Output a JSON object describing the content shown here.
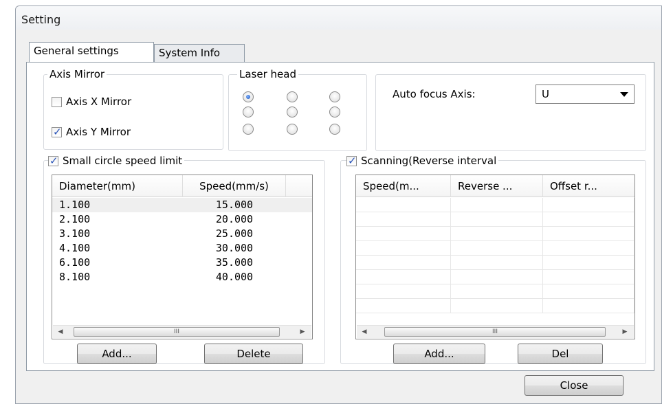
{
  "window": {
    "title": "Setting"
  },
  "tabs": [
    {
      "label": "General settings",
      "active": true
    },
    {
      "label": "System Info",
      "active": false
    }
  ],
  "axis_mirror": {
    "legend": "Axis Mirror",
    "x_mirror": {
      "label": "Axis X Mirror",
      "checked": false
    },
    "y_mirror": {
      "label": "Axis Y Mirror",
      "checked": true
    }
  },
  "laser_head": {
    "legend": "Laser head",
    "selected_index": 0
  },
  "auto_focus": {
    "label": "Auto focus Axis:",
    "value": "U"
  },
  "small_circle": {
    "checkbox_label": "Small circle speed limit",
    "checked": true,
    "columns": [
      "Diameter(mm)",
      "Speed(mm/s)"
    ],
    "rows": [
      {
        "diameter": "1.100",
        "speed": "15.000"
      },
      {
        "diameter": "2.100",
        "speed": "20.000"
      },
      {
        "diameter": "3.100",
        "speed": "25.000"
      },
      {
        "diameter": "4.100",
        "speed": "30.000"
      },
      {
        "diameter": "6.100",
        "speed": "35.000"
      },
      {
        "diameter": "8.100",
        "speed": "40.000"
      }
    ],
    "add_button": "Add...",
    "delete_button": "Delete"
  },
  "scanning": {
    "checkbox_label": "Scanning(Reverse interval",
    "checked": true,
    "columns": [
      "Speed(m...",
      "Reverse ...",
      "Offset r..."
    ],
    "add_button": "Add...",
    "del_button": "Del"
  },
  "close_button": "Close",
  "scroll": {
    "grip": "III",
    "left": "◀",
    "right": "▶"
  }
}
